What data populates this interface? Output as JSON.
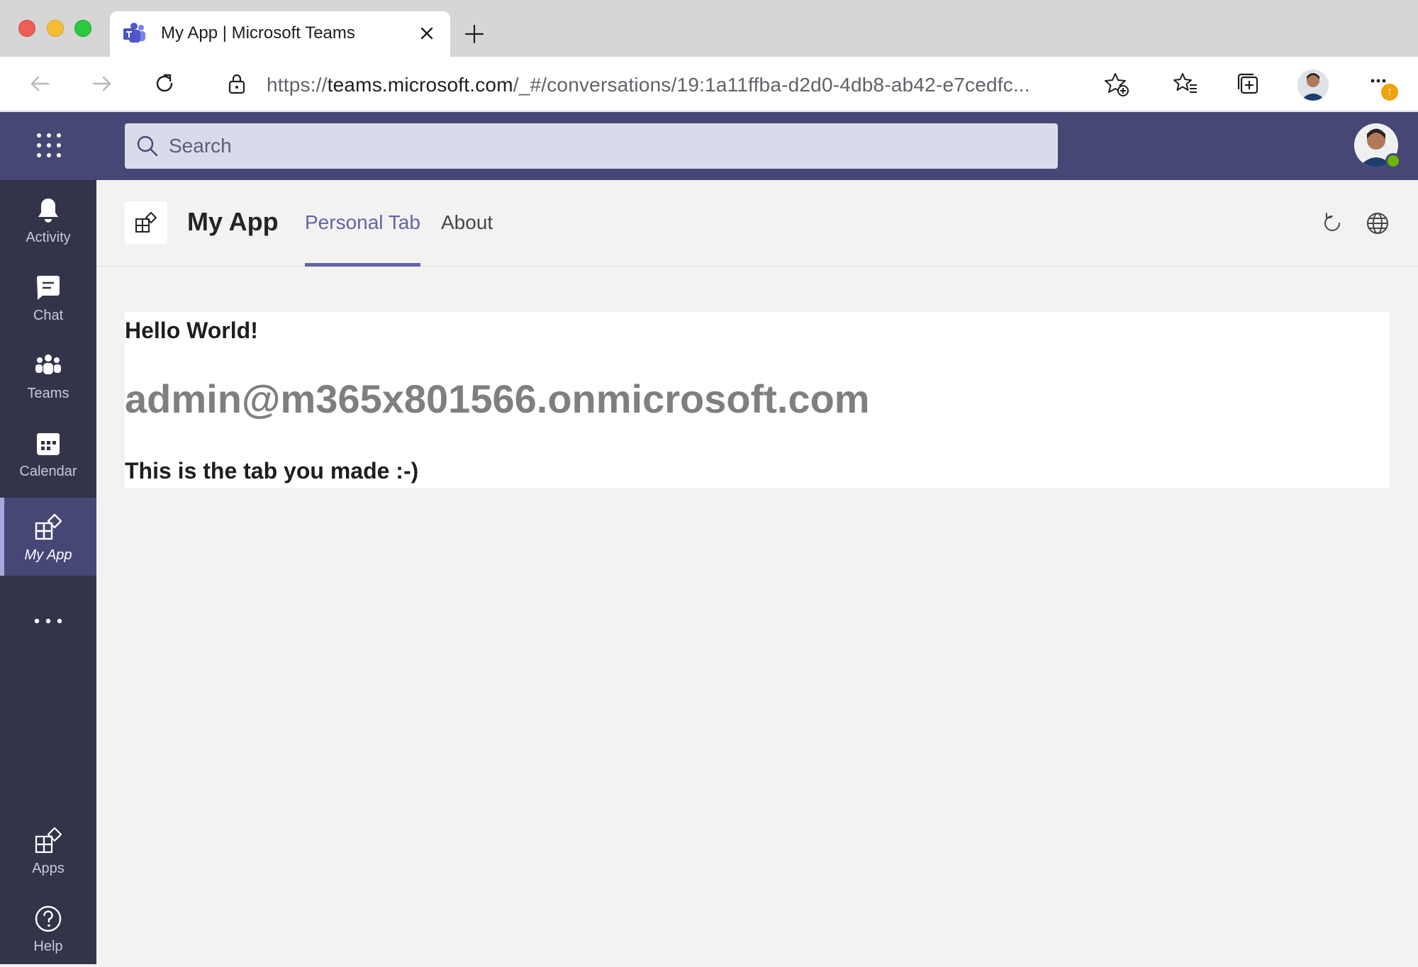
{
  "browser": {
    "tab_title": "My App | Microsoft Teams",
    "url_prefix": "https://",
    "url_host": "teams.microsoft.com",
    "url_path": "/_#/conversations/19:1a11ffba-d2d0-4db8-ab42-e7cedfc..."
  },
  "teams": {
    "search_placeholder": "Search"
  },
  "rail": {
    "items": [
      {
        "label": "Activity",
        "icon": "bell-icon"
      },
      {
        "label": "Chat",
        "icon": "chat-icon"
      },
      {
        "label": "Teams",
        "icon": "teams-icon"
      },
      {
        "label": "Calendar",
        "icon": "calendar-icon"
      },
      {
        "label": "My App",
        "icon": "app-icon",
        "active": true
      },
      {
        "label": "Apps",
        "icon": "apps-icon"
      },
      {
        "label": "Help",
        "icon": "help-icon"
      }
    ]
  },
  "app": {
    "title": "My App",
    "tabs": [
      {
        "label": "Personal Tab",
        "active": true
      },
      {
        "label": "About"
      }
    ]
  },
  "content": {
    "greeting": "Hello World!",
    "email": "admin@m365x801566.onmicrosoft.com",
    "message": "This is the tab you made :-)"
  },
  "colors": {
    "teams_purple": "#464775",
    "rail_bg": "#33344a",
    "accent": "#6264a7"
  }
}
